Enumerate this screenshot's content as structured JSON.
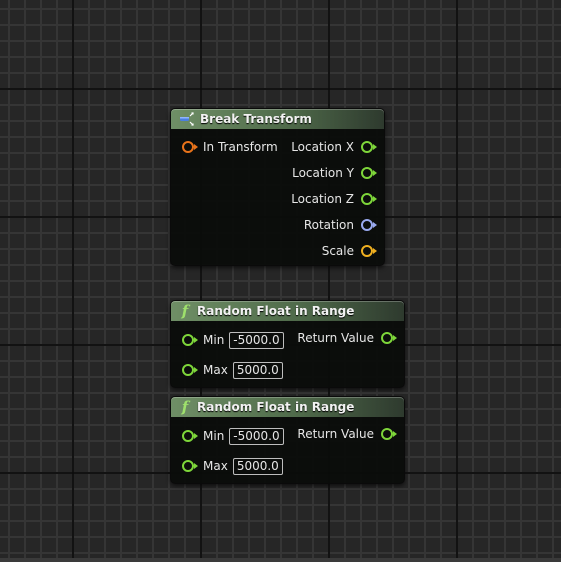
{
  "colors": {
    "pin_float": "#7ed63a",
    "pin_transform": "#e8731a",
    "pin_rotation": "#9aaaf0",
    "pin_vector_scale": "#f0b020",
    "header_green": "#6f8f66"
  },
  "nodes": [
    {
      "title": "Break Transform",
      "icon": "break-struct-icon",
      "inputs": [
        {
          "label": "In Transform",
          "type": "transform"
        }
      ],
      "outputs": [
        {
          "label": "Location X",
          "type": "float"
        },
        {
          "label": "Location Y",
          "type": "float"
        },
        {
          "label": "Location Z",
          "type": "float"
        },
        {
          "label": "Rotation",
          "type": "rotator"
        },
        {
          "label": "Scale",
          "type": "vector"
        }
      ]
    },
    {
      "title": "Random Float in Range",
      "icon": "function-icon",
      "inputs": [
        {
          "label": "Min",
          "value": "-5000.0"
        },
        {
          "label": "Max",
          "value": "5000.0"
        }
      ],
      "outputs": [
        {
          "label": "Return Value"
        }
      ]
    },
    {
      "title": "Random Float in Range",
      "icon": "function-icon",
      "inputs": [
        {
          "label": "Min",
          "value": "-5000.0"
        },
        {
          "label": "Max",
          "value": "5000.0"
        }
      ],
      "outputs": [
        {
          "label": "Return Value"
        }
      ]
    }
  ]
}
